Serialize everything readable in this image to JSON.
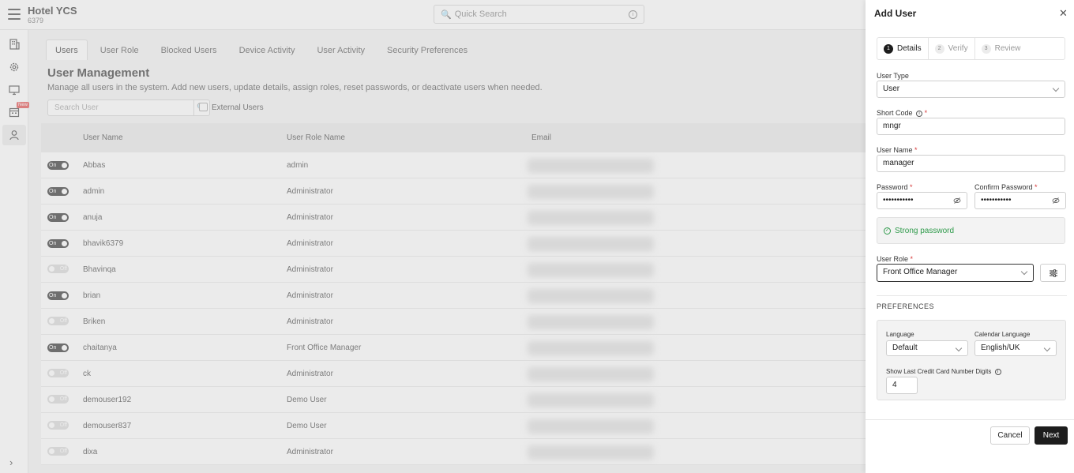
{
  "app": {
    "hotel_name": "Hotel YCS",
    "hotel_code": "6379",
    "quick_search_placeholder": "Quick Search",
    "sidebar_new_badge": "New"
  },
  "main": {
    "tabs": [
      "Users",
      "User Role",
      "Blocked Users",
      "Device Activity",
      "User Activity",
      "Security Preferences"
    ],
    "title": "User Management",
    "description": "Manage all users in the system. Add new users, update details, assign roles, reset passwords, or deactivate users when needed.",
    "search_placeholder": "Search User",
    "external_users_label": "External Users",
    "columns": [
      "User Name",
      "User Role Name",
      "Email"
    ],
    "rows": [
      {
        "toggle": "On",
        "name": "Abbas",
        "role": "admin"
      },
      {
        "toggle": "On",
        "name": "admin",
        "role": "Administrator"
      },
      {
        "toggle": "On",
        "name": "anuja",
        "role": "Administrator"
      },
      {
        "toggle": "On",
        "name": "bhavik6379",
        "role": "Administrator"
      },
      {
        "toggle": "Off",
        "name": "Bhavinqa",
        "role": "Administrator"
      },
      {
        "toggle": "On",
        "name": "brian",
        "role": "Administrator"
      },
      {
        "toggle": "Off",
        "name": "Briken",
        "role": "Administrator"
      },
      {
        "toggle": "On",
        "name": "chaitanya",
        "role": "Front Office Manager"
      },
      {
        "toggle": "Off",
        "name": "ck",
        "role": "Administrator"
      },
      {
        "toggle": "Off",
        "name": "demouser192",
        "role": "Demo User"
      },
      {
        "toggle": "Off",
        "name": "demouser837",
        "role": "Demo User"
      },
      {
        "toggle": "Off",
        "name": "dixa",
        "role": "Administrator"
      }
    ]
  },
  "drawer": {
    "title": "Add User",
    "steps": [
      {
        "num": "1",
        "label": "Details"
      },
      {
        "num": "2",
        "label": "Verify"
      },
      {
        "num": "3",
        "label": "Review"
      }
    ],
    "user_type_label": "User Type",
    "user_type_value": "User",
    "short_code_label": "Short Code",
    "short_code_value": "mngr",
    "user_name_label": "User Name",
    "user_name_value": "manager",
    "password_label": "Password",
    "password_value": "•••••••••••",
    "confirm_password_label": "Confirm Password",
    "confirm_password_value": "•••••••••••",
    "password_strength": "Strong password",
    "user_role_label": "User Role",
    "user_role_value": "Front Office Manager",
    "preferences_title": "PREFERENCES",
    "language_label": "Language",
    "language_value": "Default",
    "calendar_language_label": "Calendar Language",
    "calendar_language_value": "English/UK",
    "cc_digits_label": "Show Last Credit Card Number Digits",
    "cc_digits_value": "4",
    "required_mark": "*",
    "cancel_label": "Cancel",
    "next_label": "Next"
  }
}
